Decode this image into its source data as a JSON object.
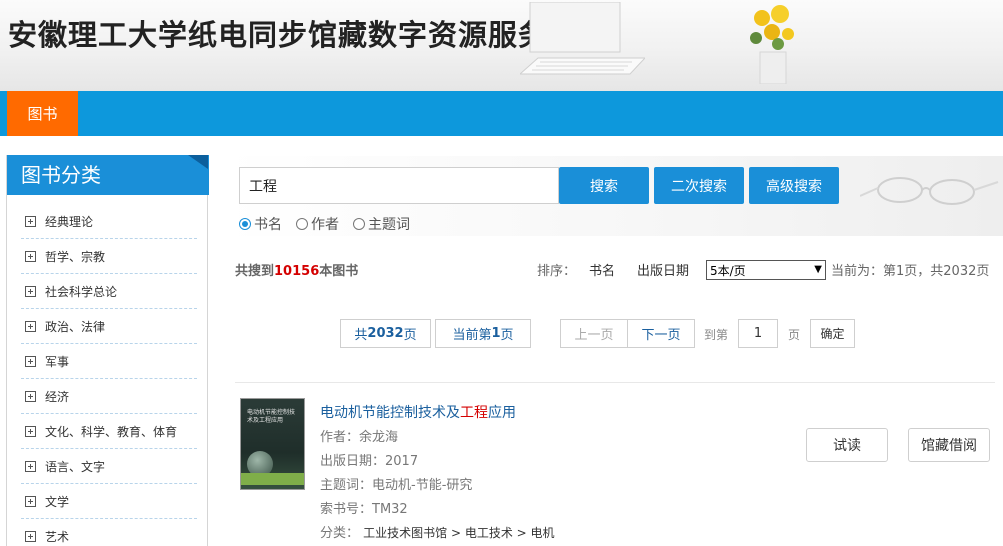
{
  "site": {
    "title": "安徽理工大学纸电同步馆藏数字资源服务平台"
  },
  "nav": {
    "tabs": [
      {
        "label": "图书",
        "active": true
      }
    ]
  },
  "sidebar": {
    "heading": "图书分类",
    "categories": [
      {
        "label": "经典理论"
      },
      {
        "label": "哲学、宗教"
      },
      {
        "label": "社会科学总论"
      },
      {
        "label": "政治、法律"
      },
      {
        "label": "军事"
      },
      {
        "label": "经济"
      },
      {
        "label": "文化、科学、教育、体育"
      },
      {
        "label": "语言、文字"
      },
      {
        "label": "文学"
      },
      {
        "label": "艺术"
      }
    ]
  },
  "search": {
    "query": "工程",
    "buttons": {
      "search": "搜索",
      "secondary": "二次搜索",
      "advanced": "高级搜索"
    },
    "fields": [
      {
        "label": "书名",
        "checked": true
      },
      {
        "label": "作者",
        "checked": false
      },
      {
        "label": "主题词",
        "checked": false
      }
    ]
  },
  "results": {
    "summary_prefix": "共搜到",
    "count": "10156",
    "summary_suffix": "本图书",
    "sort_label": "排序：",
    "sort_options": [
      "书名",
      "出版日期"
    ],
    "per_page": "5本/页",
    "page_info": "当前为：第1页，共2032页"
  },
  "pagination": {
    "total_prefix": "共",
    "total_pages": "2032",
    "total_suffix": "页",
    "current_prefix": "当前第",
    "current_page": "1",
    "current_suffix": "页",
    "prev": "上一页",
    "next": "下一页",
    "goto_label": "到第",
    "goto_value": "1",
    "goto_suffix": "页",
    "confirm": "确定"
  },
  "book": {
    "title_before": "电动机节能控制技术及",
    "title_highlight": "工程",
    "title_after": "应用",
    "cover_text": "电动机节能控制技术及工程应用",
    "author": "作者：余龙海",
    "pub_date": "出版日期：2017",
    "subject": "主题词：电动机-节能-研究",
    "call_number": "索书号：TM32",
    "class_label": "分类：",
    "class_path": "工业技术图书馆 > 电工技术 > 电机",
    "btn_preview": "试读",
    "btn_borrow": "馆藏借阅"
  },
  "colors": {
    "nav_blue": "#0d98dc",
    "tab_orange": "#ff6a00",
    "button_blue": "#1a8fd8",
    "highlight_red": "#d40000"
  }
}
